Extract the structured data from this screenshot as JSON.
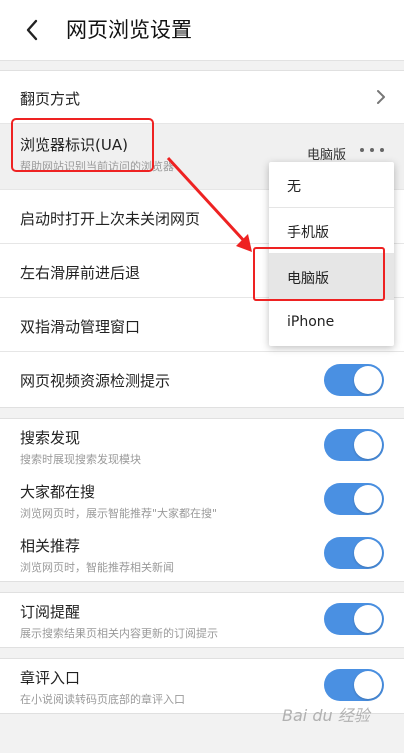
{
  "header": {
    "title": "网页浏览设置",
    "back_icon": "chevron-left-icon"
  },
  "settings": {
    "page_flip": {
      "label": "翻页方式"
    },
    "ua": {
      "label": "浏览器标识(UA)",
      "sub": "帮助网站识别当前访问的浏览器",
      "value": "电脑版"
    },
    "restore": {
      "label": "启动时打开上次未关闭网页"
    },
    "swipe": {
      "label": "左右滑屏前进后退"
    },
    "two_finger": {
      "label": "双指滑动管理窗口"
    },
    "video_detect": {
      "label": "网页视频资源检测提示",
      "on": true
    }
  },
  "search": {
    "discover": {
      "label": "搜索发现",
      "sub": "搜索时展现搜索发现模块",
      "on": true
    },
    "trending": {
      "label": "大家都在搜",
      "sub": "浏览网页时，展示智能推荐\"大家都在搜\"",
      "on": true
    },
    "related": {
      "label": "相关推荐",
      "sub": "浏览网页时，智能推荐相关新闻",
      "on": true
    }
  },
  "subscribe": {
    "label": "订阅提醒",
    "sub": "展示搜索结果页相关内容更新的订阅提示",
    "on": true
  },
  "comment": {
    "label": "章评入口",
    "sub": "在小说阅读转码页底部的章评入口",
    "on": true
  },
  "ua_dropdown": {
    "options": [
      "无",
      "手机版",
      "电脑版",
      "iPhone"
    ],
    "selected": "电脑版"
  },
  "colors": {
    "accent": "#4a90e2",
    "highlight": "#ee2222"
  },
  "watermark": "Bai du 经验"
}
